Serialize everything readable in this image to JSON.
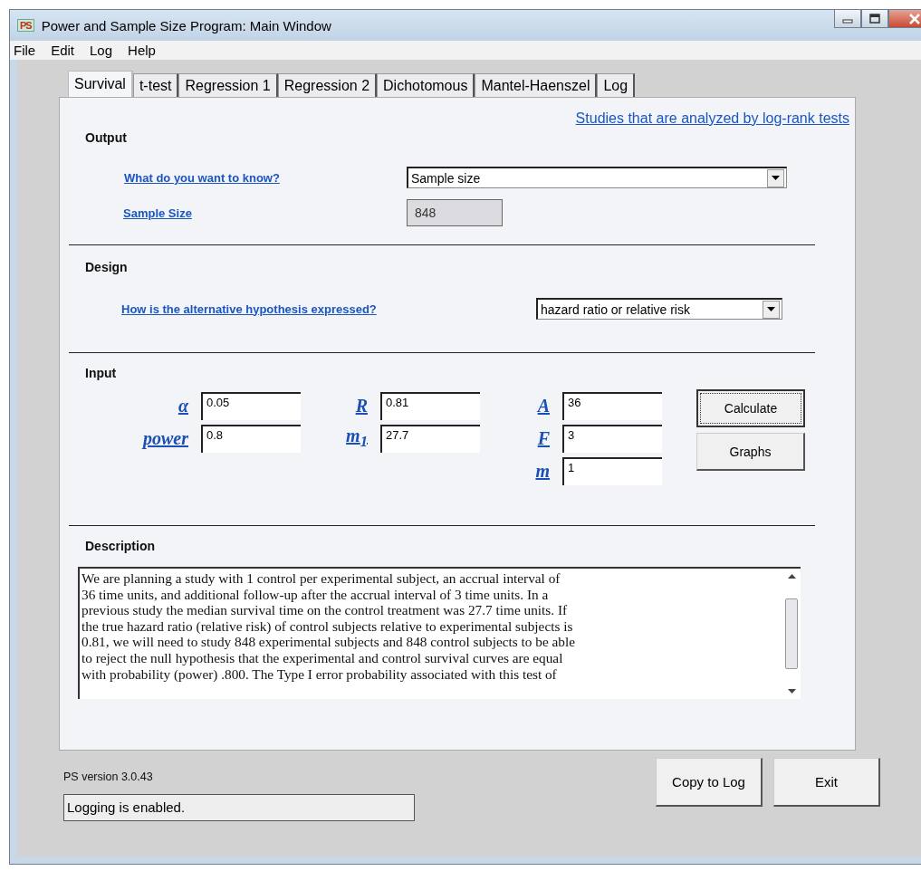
{
  "window": {
    "title": "Power and Sample Size Program:  Main Window",
    "app_icon": "PS"
  },
  "menu": [
    "File",
    "Edit",
    "Log",
    "Help"
  ],
  "tabs": [
    {
      "label": "Survival",
      "selected": true
    },
    {
      "label": "t-test",
      "selected": false
    },
    {
      "label": "Regression 1",
      "selected": false
    },
    {
      "label": "Regression 2",
      "selected": false
    },
    {
      "label": "Dichotomous",
      "selected": false
    },
    {
      "label": "Mantel-Haenszel",
      "selected": false
    },
    {
      "label": "Log",
      "selected": false
    }
  ],
  "panel_link": "Studies that are analyzed by log-rank tests",
  "output": {
    "heading": "Output",
    "question": "What do you want to know?",
    "answer": "Sample size",
    "result_label": "Sample Size",
    "result_value": "848",
    "result_disabled": true
  },
  "design": {
    "heading": "Design",
    "question": "How is the alternative hypothesis expressed?",
    "answer": "hazard ratio or relative risk"
  },
  "input": {
    "heading": "Input",
    "params": [
      {
        "label": "α",
        "value": "0.05"
      },
      {
        "label": "power",
        "value": "0.8"
      },
      {
        "label": "R",
        "value": "0.81"
      },
      {
        "label": "m$_{1}$",
        "value": "27.7"
      },
      {
        "label": "A",
        "value": "36"
      },
      {
        "label": "F",
        "value": "3"
      },
      {
        "label": "m",
        "value": "1"
      }
    ],
    "buttons": [
      {
        "label": "Calculate",
        "focused": true
      },
      {
        "label": "Graphs",
        "focused": false
      }
    ]
  },
  "description": {
    "heading": "Description",
    "lines": [
      "We are planning a study with 1 control per experimental subject, an accrual interval of",
      "36 time units, and additional follow-up after the accrual interval of 3 time units.  In a",
      "previous study the median survival time on the control treatment was 27.7 time units.  If",
      "the true hazard ratio (relative risk) of control subjects relative to experimental subjects is",
      "0.81, we will need to study 848 experimental subjects and 848 control subjects to be able",
      "to reject the null hypothesis that the experimental and control survival curves are equal",
      "with probability (power) .800.   The Type I error probability associated with this test of"
    ]
  },
  "version": "PS version 3.0.43",
  "footer_buttons": [
    "Copy to Log",
    "Exit"
  ],
  "status": "Logging is enabled."
}
